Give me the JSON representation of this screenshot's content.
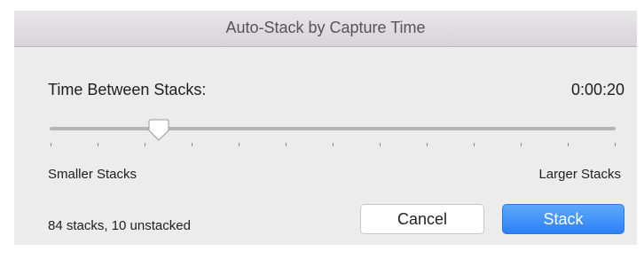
{
  "dialog": {
    "title": "Auto-Stack by Capture Time",
    "label": "Time Between Stacks:",
    "time_value": "0:00:20",
    "slider": {
      "position_fraction": 0.18,
      "tick_count": 13,
      "min_label": "Smaller Stacks",
      "max_label": "Larger Stacks"
    },
    "status": "84 stacks, 10 unstacked",
    "buttons": {
      "cancel": "Cancel",
      "stack": "Stack"
    },
    "colors": {
      "accent": "#2d80f6",
      "background": "#ececec"
    }
  }
}
